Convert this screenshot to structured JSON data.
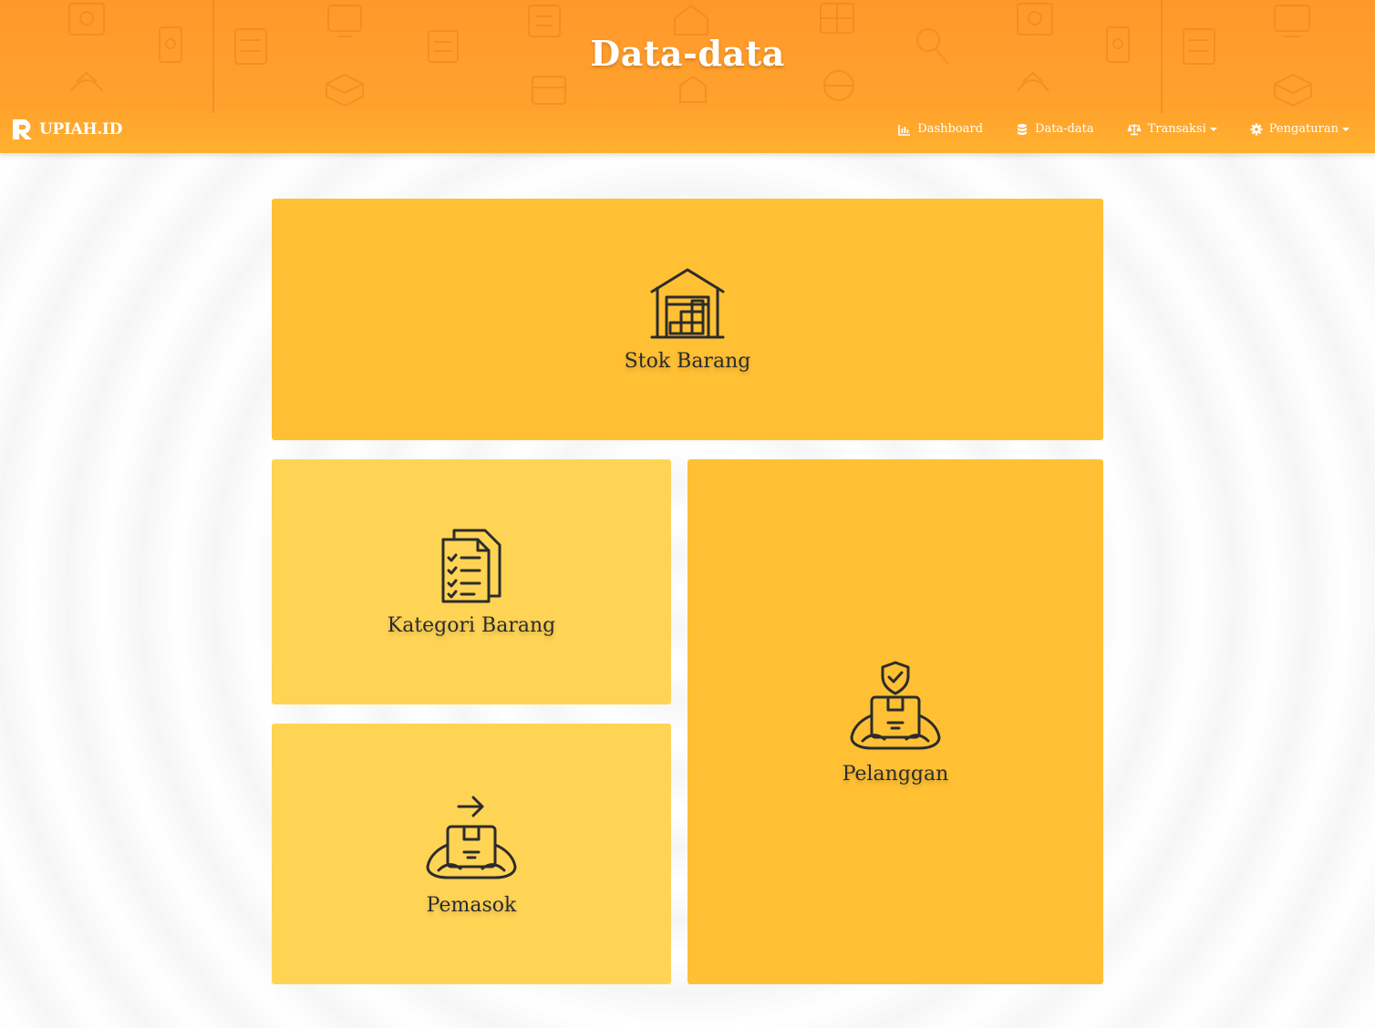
{
  "header": {
    "title": "Data-data"
  },
  "navbar": {
    "brand": "UPIAH.ID",
    "items": [
      {
        "label": "Dashboard",
        "icon": "bar-chart-icon",
        "dropdown": false
      },
      {
        "label": "Data-data",
        "icon": "database-icon",
        "dropdown": false
      },
      {
        "label": "Transaksi",
        "icon": "balance-scale-icon",
        "dropdown": true
      },
      {
        "label": "Pengaturan",
        "icon": "gear-icon",
        "dropdown": true
      }
    ]
  },
  "tiles": [
    {
      "label": "Stok Barang",
      "icon": "warehouse-icon"
    },
    {
      "label": "Kategori Barang",
      "icon": "checklist-icon"
    },
    {
      "label": "Pelanggan",
      "icon": "customer-package-icon"
    },
    {
      "label": "Pemasok",
      "icon": "supplier-package-icon"
    }
  ],
  "colors": {
    "header": "#ff9f2c",
    "tile_dark": "#ffc034",
    "tile_light": "#ffd455",
    "icon_stroke": "#2c2c2c"
  }
}
